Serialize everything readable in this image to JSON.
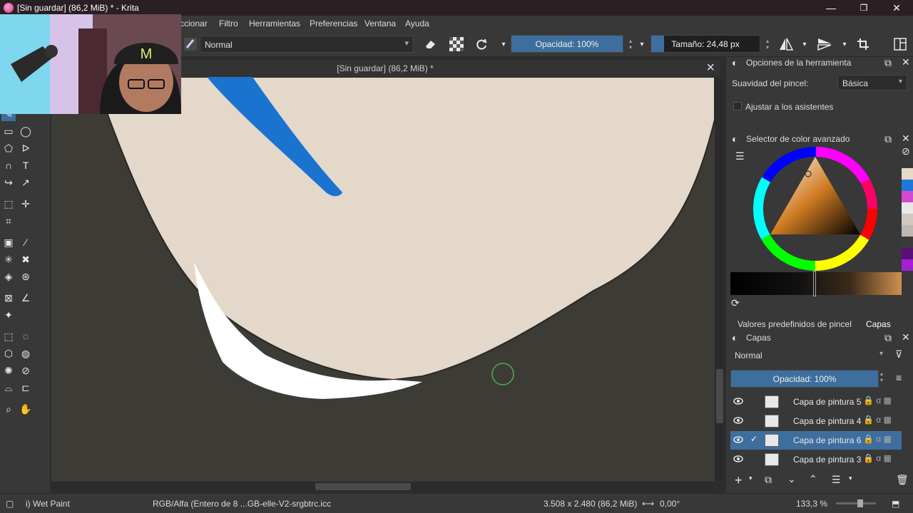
{
  "window": {
    "title": "[Sin guardar]  (86,2 MiB) * - Krita",
    "minimize": "—",
    "maximize": "❐",
    "close": "✕"
  },
  "menu": {
    "items": [
      "ccionar",
      "Filtro",
      "Herramientas",
      "Preferencias",
      "Ventana",
      "Ayuda"
    ]
  },
  "toolbar": {
    "blend_mode": "Normal",
    "opacity_label": "Opacidad: 100%",
    "opacity_value": 1.0,
    "size_label": "Tamaño: 24,48 px"
  },
  "document": {
    "tab_title": "[Sin guardar]  (86,2 MiB) *"
  },
  "tool_options": {
    "title": "Opciones de la herramienta",
    "smoothing_label": "Suavidad del pincel:",
    "smoothing_value": "Básica",
    "assistants_label": "Ajustar a los asistentes"
  },
  "color_selector": {
    "title": "Selector de color avanzado",
    "swatches": [
      "#e6d9c8",
      "#1f78d8",
      "#d24ad2",
      "#e8e8e8",
      "#cfc8c0",
      "#c0b8b0",
      "#3a3a3a",
      "#5a0f7a",
      "#a71fd2"
    ]
  },
  "panel_tabs": {
    "brush_presets": "Valores predefinidos de pincel",
    "layers": "Capas"
  },
  "layers_docker": {
    "title": "Capas",
    "blend_mode": "Normal",
    "opacity_label": "Opacidad:  100%",
    "opacity_value": 1.0,
    "layers": [
      {
        "name": "Capa de pintura 5",
        "active": false,
        "checked": false
      },
      {
        "name": "Capa de pintura 4",
        "active": false,
        "checked": false
      },
      {
        "name": "Capa de pintura 6",
        "active": true,
        "checked": true
      },
      {
        "name": "Capa de pintura 3",
        "active": false,
        "checked": false
      }
    ]
  },
  "status": {
    "brush_preset": "i) Wet Paint",
    "color_space": "RGB/Alfa (Entero de 8 ...GB-elle-V2-srgbtrc.icc",
    "dimensions": "3.508 x 2.480 (86,2 MiB)",
    "rotation": "0,00°",
    "zoom": "133,3 %"
  },
  "colors": {
    "accent": "#3d6e9e",
    "canvas_skin": "#e3d8ca",
    "canvas_dark": "#3d3b36",
    "stroke_blue": "#1a73cf"
  }
}
